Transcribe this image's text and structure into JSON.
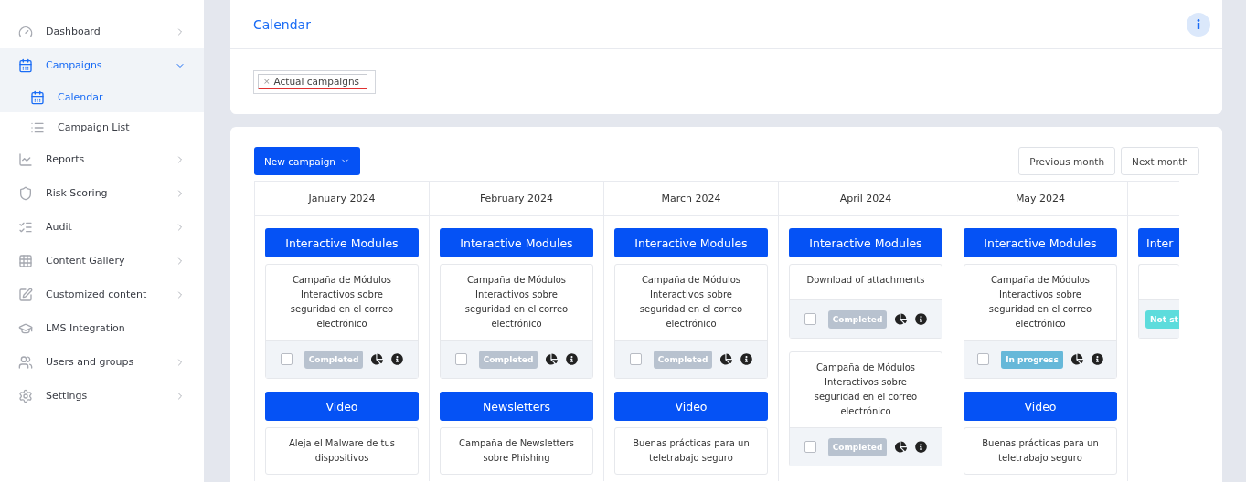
{
  "sidebar": {
    "items": [
      {
        "label": "Dashboard",
        "selected": false,
        "expandable": true
      },
      {
        "label": "Campaigns",
        "selected": true,
        "expandable": true,
        "expanded": true,
        "children": [
          {
            "label": "Calendar",
            "selected": true
          },
          {
            "label": "Campaign List",
            "selected": false
          }
        ]
      },
      {
        "label": "Reports",
        "selected": false,
        "expandable": true
      },
      {
        "label": "Risk Scoring",
        "selected": false,
        "expandable": true
      },
      {
        "label": "Audit",
        "selected": false,
        "expandable": true
      },
      {
        "label": "Content Gallery",
        "selected": false,
        "expandable": true
      },
      {
        "label": "Customized content",
        "selected": false,
        "expandable": true
      },
      {
        "label": "LMS Integration",
        "selected": false,
        "expandable": false
      },
      {
        "label": "Users and groups",
        "selected": false,
        "expandable": true
      },
      {
        "label": "Settings",
        "selected": false,
        "expandable": true
      }
    ]
  },
  "header": {
    "title": "Calendar",
    "filter": {
      "tags": [
        {
          "label": "Actual campaigns",
          "remove": "×"
        }
      ]
    }
  },
  "toolbar": {
    "new_button": "New campaign",
    "prev_button": "Previous month",
    "next_button": "Next month"
  },
  "months": [
    {
      "label": "January 2024",
      "cut": false,
      "items": [
        {
          "kind": "group",
          "label": "Interactive Modules"
        },
        {
          "kind": "campaign",
          "title": "Campaña de Módulos Interactivos sobre seguridad en el correo electrónico",
          "checked": false,
          "badge": {
            "kind": "completed",
            "label": "Completed"
          }
        },
        {
          "kind": "group",
          "label": "Video"
        },
        {
          "kind": "campaign",
          "title": "Aleja el Malware de tus dispositivos"
        }
      ]
    },
    {
      "label": "February 2024",
      "cut": false,
      "items": [
        {
          "kind": "group",
          "label": "Interactive Modules"
        },
        {
          "kind": "campaign",
          "title": "Campaña de Módulos Interactivos sobre seguridad en el correo electrónico",
          "checked": false,
          "badge": {
            "kind": "completed",
            "label": "Completed"
          }
        },
        {
          "kind": "group",
          "label": "Newsletters"
        },
        {
          "kind": "campaign",
          "title": "Campaña de Newsletters sobre Phishing"
        }
      ]
    },
    {
      "label": "March 2024",
      "cut": false,
      "items": [
        {
          "kind": "group",
          "label": "Interactive Modules"
        },
        {
          "kind": "campaign",
          "title": "Campaña de Módulos Interactivos sobre seguridad en el correo electrónico",
          "checked": false,
          "badge": {
            "kind": "completed",
            "label": "Completed"
          }
        },
        {
          "kind": "group",
          "label": "Video"
        },
        {
          "kind": "campaign",
          "title": "Buenas prácticas para un teletrabajo seguro"
        }
      ]
    },
    {
      "label": "April 2024",
      "cut": false,
      "items": [
        {
          "kind": "group",
          "label": "Interactive Modules"
        },
        {
          "kind": "campaign",
          "title": "Download of attachments",
          "checked": false,
          "badge": {
            "kind": "completed",
            "label": "Completed"
          }
        },
        {
          "kind": "campaign",
          "title": "Campaña de Módulos Interactivos sobre seguridad en el correo electrónico",
          "checked": false,
          "badge": {
            "kind": "completed",
            "label": "Completed"
          }
        }
      ]
    },
    {
      "label": "May 2024",
      "cut": false,
      "items": [
        {
          "kind": "group",
          "label": "Interactive Modules"
        },
        {
          "kind": "campaign",
          "title": "Campaña de Módulos Interactivos sobre seguridad en el correo electrónico",
          "checked": false,
          "badge": {
            "kind": "in_progress",
            "label": "In progress"
          }
        },
        {
          "kind": "group",
          "label": "Video"
        },
        {
          "kind": "campaign",
          "title": "Buenas prácticas para un teletrabajo seguro"
        }
      ]
    },
    {
      "cut": true,
      "items": [
        {
          "kind": "group",
          "label": "Inter"
        },
        {
          "kind": "campaign",
          "badge": {
            "kind": "not_started",
            "label": "Not st"
          }
        }
      ]
    }
  ]
}
